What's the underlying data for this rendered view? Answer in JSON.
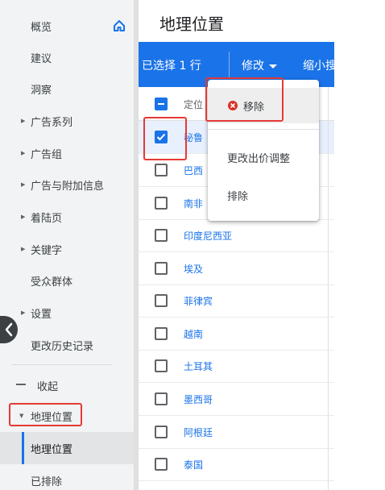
{
  "sidebar": {
    "items": [
      {
        "label": "概览"
      },
      {
        "label": "建议"
      },
      {
        "label": "洞察"
      },
      {
        "label": "广告系列"
      },
      {
        "label": "广告组"
      },
      {
        "label": "广告与附加信息"
      },
      {
        "label": "着陆页"
      },
      {
        "label": "关键字"
      },
      {
        "label": "受众群体"
      },
      {
        "label": "设置"
      },
      {
        "label": "更改历史记录"
      }
    ],
    "collapse_label": "收起",
    "geo_label": "地理位置",
    "sub_items": [
      {
        "label": "地理位置"
      },
      {
        "label": "已排除"
      }
    ]
  },
  "main": {
    "title": "地理位置",
    "action_bar": {
      "selected_text": "已选择 1 行",
      "edit_label": "修改",
      "shrink_label": "缩小搜"
    },
    "table": {
      "column_header": "定位",
      "rows": [
        {
          "name": "秘鲁",
          "checked": true
        },
        {
          "name": "巴西",
          "checked": false
        },
        {
          "name": "南非",
          "checked": false
        },
        {
          "name": "印度尼西亚",
          "checked": false
        },
        {
          "name": "埃及",
          "checked": false
        },
        {
          "name": "菲律宾",
          "checked": false
        },
        {
          "name": "越南",
          "checked": false
        },
        {
          "name": "土耳其",
          "checked": false
        },
        {
          "name": "墨西哥",
          "checked": false
        },
        {
          "name": "阿根廷",
          "checked": false
        },
        {
          "name": "泰国",
          "checked": false
        }
      ]
    }
  },
  "menu": {
    "remove_label": "移除",
    "bid_adjust_label": "更改出价调整",
    "exclude_label": "排除"
  },
  "colors": {
    "accent": "#1a73e8",
    "highlight": "#e53935",
    "remove_icon": "#d93025"
  }
}
